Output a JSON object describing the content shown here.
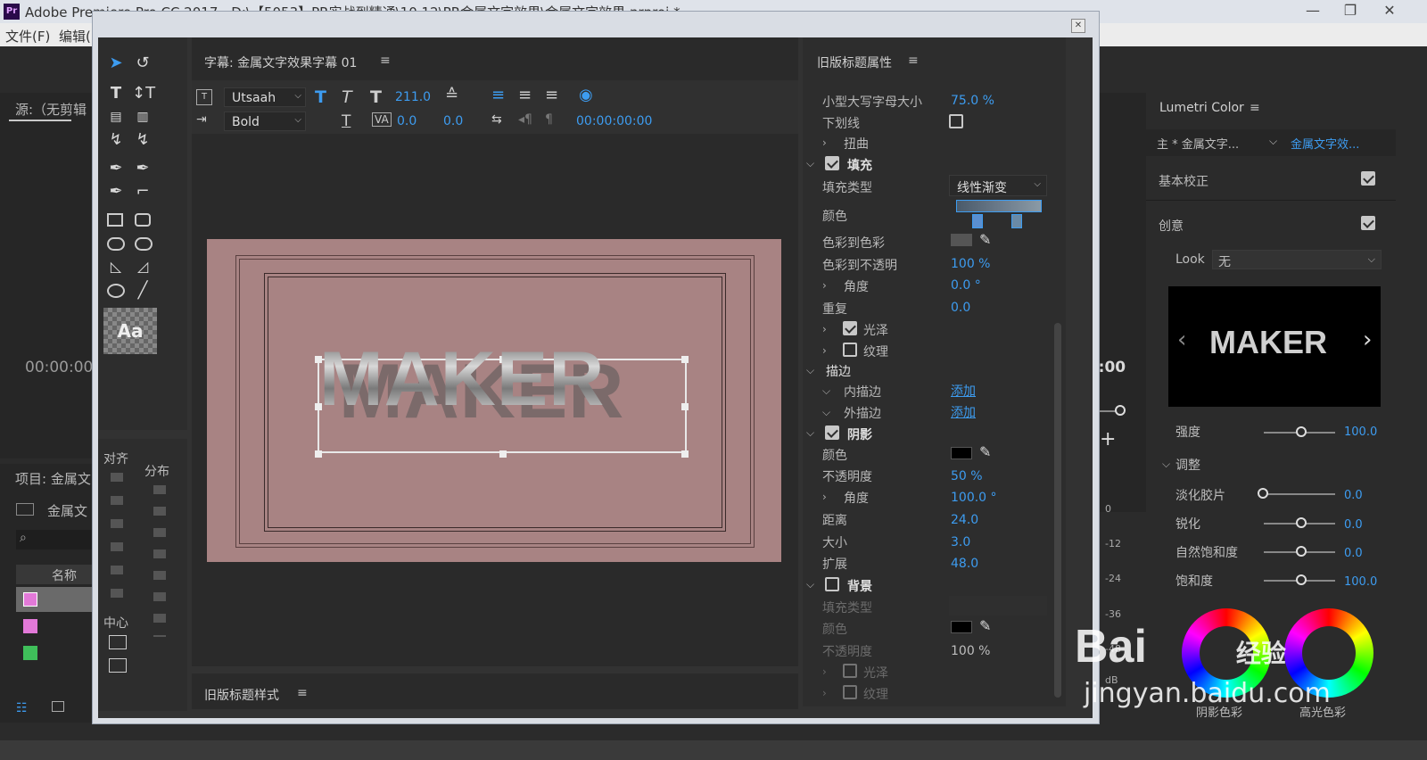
{
  "app": {
    "title": "Adobe Premiere Pro CC 2017 - D:\\【5053】PR实战到精通\\10.12\\PR金属文字效果\\金属文字效果.prproj *",
    "menu": [
      "文件(F)",
      "编辑("
    ],
    "source_label": "源:（无剪辑",
    "timecode_left": "00:00:00",
    "timecode_right": "05:00",
    "project_label": "项目: 金属文",
    "project_bin": "金属文",
    "col_name": "名称"
  },
  "titler": {
    "title": "字幕: 金属文字效果字幕 01",
    "font": "Utsaah",
    "weight": "Bold",
    "size": "211.0",
    "kerning": "0.0",
    "tracking": "0.0",
    "timecode": "00:00:00:00",
    "text": "MAKER"
  },
  "align": {
    "label_align": "对齐",
    "label_distribute": "分布",
    "label_center": "中心"
  },
  "style": {
    "title": "旧版标题样式"
  },
  "props": {
    "title": "旧版标题属性",
    "smallcaps_label": "小型大写字母大小",
    "smallcaps_val": "75.0 %",
    "underline_label": "下划线",
    "distort_label": "扭曲",
    "fill_label": "填充",
    "filltype_label": "填充类型",
    "filltype_val": "线性渐变",
    "color_label": "颜色",
    "c2c_label": "色彩到色彩",
    "c2o_label": "色彩到不透明",
    "c2o_val": "100 %",
    "angle_label": "角度",
    "angle_val": "0.0 °",
    "repeat_label": "重复",
    "repeat_val": "0.0",
    "sheen_label": "光泽",
    "texture_label": "纹理",
    "stroke_label": "描边",
    "inner_label": "内描边",
    "outer_label": "外描边",
    "add": "添加",
    "shadow_label": "阴影",
    "sh_color_label": "颜色",
    "sh_opacity_label": "不透明度",
    "sh_opacity_val": "50 %",
    "sh_angle_label": "角度",
    "sh_angle_val": "100.0 °",
    "sh_dist_label": "距离",
    "sh_dist_val": "24.0",
    "sh_size_label": "大小",
    "sh_size_val": "3.0",
    "sh_spread_label": "扩展",
    "sh_spread_val": "48.0",
    "bg_label": "背景",
    "bg_filltype_label": "填充类型",
    "bg_color_label": "颜色",
    "bg_opacity_label": "不透明度",
    "bg_opacity_val": "100 %",
    "bg_sheen_label": "光泽",
    "bg_texture_label": "纹理"
  },
  "lumetri": {
    "title": "Lumetri Color",
    "tab_main": "主 * 金属文字...",
    "tab_clip": "金属文字效...",
    "basic": "基本校正",
    "creative": "创意",
    "look_label": "Look",
    "look_val": "无",
    "preview_text": "MAKER",
    "intensity_label": "强度",
    "intensity_val": "100.0",
    "adjust_label": "调整",
    "faded_label": "淡化胶片",
    "faded_val": "0.0",
    "sharpen_label": "锐化",
    "sharpen_val": "0.0",
    "vibrance_label": "自然饱和度",
    "vibrance_val": "0.0",
    "saturation_label": "饱和度",
    "saturation_val": "100.0",
    "shadow_tint": "阴影色彩",
    "highlight_tint": "高光色彩"
  },
  "meter": {
    "ticks": [
      "0",
      "-12",
      "-24",
      "-36",
      "-48"
    ],
    "unit": "dB"
  },
  "watermark": {
    "brand": "Bai",
    "brand2": "经验",
    "url": "jingyan.baidu.com"
  },
  "colors": {
    "accent": "#3d9cf0",
    "canvas": "#a88383"
  }
}
